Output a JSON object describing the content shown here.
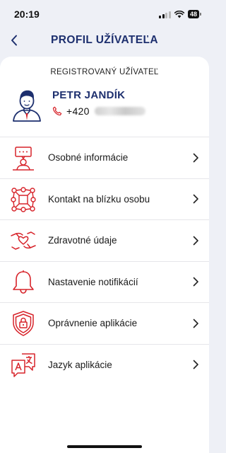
{
  "status_bar": {
    "time": "20:19",
    "battery": "48",
    "icons": [
      "signal-icon",
      "wifi-icon",
      "battery-icon"
    ]
  },
  "nav": {
    "title": "PROFIL UŽÍVATEĽA",
    "back_icon": "chevron-left-icon"
  },
  "user": {
    "header": "REGISTROVANÝ UŽÍVATEĽ",
    "name": "PETR JANDÍK",
    "phone_prefix": "+420",
    "avatar_icon": "user-avatar-icon",
    "phone_icon": "phone-icon"
  },
  "menu": {
    "items": [
      {
        "label": "Osobné informácie",
        "icon": "personal-info-icon"
      },
      {
        "label": "Kontakt na blízku osobu",
        "icon": "contact-network-icon"
      },
      {
        "label": "Zdravotné údaje",
        "icon": "health-hands-heart-icon"
      },
      {
        "label": "Nastavenie notifikácií",
        "icon": "bell-icon"
      },
      {
        "label": "Oprávnenie aplikácie",
        "icon": "shield-lock-icon"
      },
      {
        "label": "Jazyk aplikácie",
        "icon": "language-icon"
      }
    ]
  },
  "colors": {
    "accent_red": "#d7232a",
    "navy": "#1d2f6e",
    "background": "#eef0f6"
  }
}
